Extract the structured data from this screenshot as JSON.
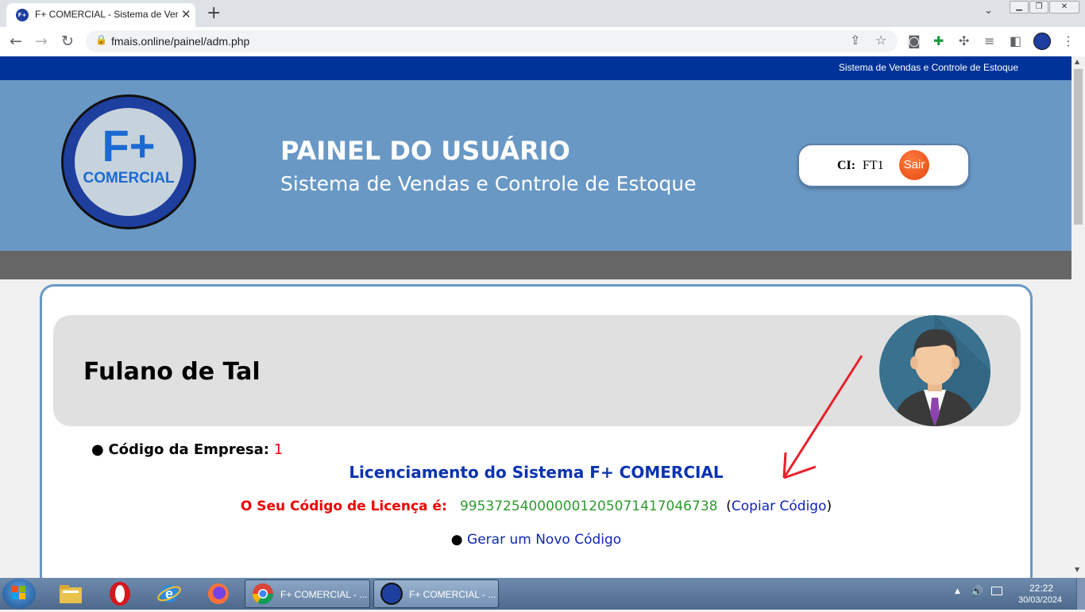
{
  "browser": {
    "tab_title": "F+ COMERCIAL - Sistema de Vendas e Controle de Estoque",
    "favicon_text": "F+",
    "url": "fmais.online/painel/adm.php"
  },
  "page": {
    "topstrip_text": "Sistema de Vendas e Controle de Estoque",
    "logo_fplus": "F+",
    "logo_comercial": "COMERCIAL",
    "hero_title": "PAINEL DO USUÁRIO",
    "hero_subtitle": "Sistema de Vendas e Controle de Estoque",
    "ci_label": "CI:",
    "ci_value": "FT1",
    "sair_label": "Sair",
    "user_name": "Fulano de Tal",
    "empresa_label": "Código da Empresa:",
    "empresa_value": "1",
    "license_title": "Licenciamento do Sistema F+ COMERCIAL",
    "license_label": "O Seu Código de Licença é:",
    "license_code": "995372540000001205071417046738",
    "copy_open": "(",
    "copy_link": "Copiar Código",
    "copy_close": ")",
    "new_code_link": "Gerar um Novo Código",
    "colors": {
      "topstrip": "#003399",
      "hero": "#6998c5",
      "title_blue": "#0a33b0",
      "code_green": "#2e9a2e",
      "label_red": "#ee0000"
    }
  },
  "taskbar": {
    "tasks": [
      {
        "label": "F+ COMERCIAL - ..."
      },
      {
        "label": "F+ COMERCIAL - ..."
      }
    ],
    "time": "22:22",
    "date": "30/03/2024"
  }
}
